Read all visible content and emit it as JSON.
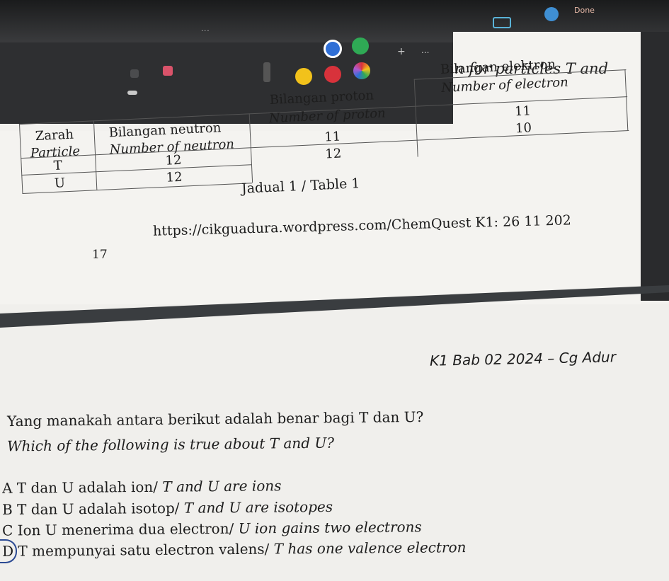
{
  "toolbar": {
    "done_label": "Done",
    "more_label": "...",
    "plus_label": "+",
    "more_tools_label": "...",
    "icons": [
      "pen-icon",
      "profile-icon"
    ],
    "swatches": {
      "blue": "#2f6fd6",
      "green": "#2faa55",
      "yellow": "#f2c21b",
      "red": "#d8323b",
      "multicolor": "#b05ad0"
    }
  },
  "header_fragment": "n for particles T and",
  "table": {
    "headers": {
      "particle_ms": "Zarah",
      "particle_en": "Particle",
      "neutron_ms": "Bilangan neutron",
      "neutron_en": "Number of neutron",
      "proton_ms": "Bilangan proton",
      "proton_en": "Number of proton",
      "electron_ms": "Bilangan elektron",
      "electron_en": "Number of electron"
    },
    "rows": [
      {
        "particle": "T",
        "neutron": "12",
        "proton": "11",
        "electron": "11"
      },
      {
        "particle": "U",
        "neutron": "12",
        "proton": "12",
        "electron": "10"
      }
    ],
    "caption": "Jadual 1 / Table 1"
  },
  "question_number": "17",
  "source_url": "https://cikguadura.wordpress.com/ChemQuest K1: 26 11 202",
  "page_header": "K1 Bab 02 2024 – Cg Adur",
  "question": {
    "text_ms": "Yang manakah antara berikut adalah benar bagi T dan U?",
    "text_en": "Which of the following is true about T and U?",
    "options": [
      {
        "letter": "A",
        "text_ms": "T dan U adalah ion/",
        "text_en": "T and U are ions"
      },
      {
        "letter": "B",
        "text_ms": "T dan U adalah isotop/",
        "text_en": "T and U are isotopes"
      },
      {
        "letter": "C",
        "text_ms": "Ion U menerima dua electron/",
        "text_en": "U ion gains two electrons"
      },
      {
        "letter": "D",
        "text_ms": "T mempunyai satu electron valens/",
        "text_en": "T has one valence electron"
      }
    ]
  }
}
